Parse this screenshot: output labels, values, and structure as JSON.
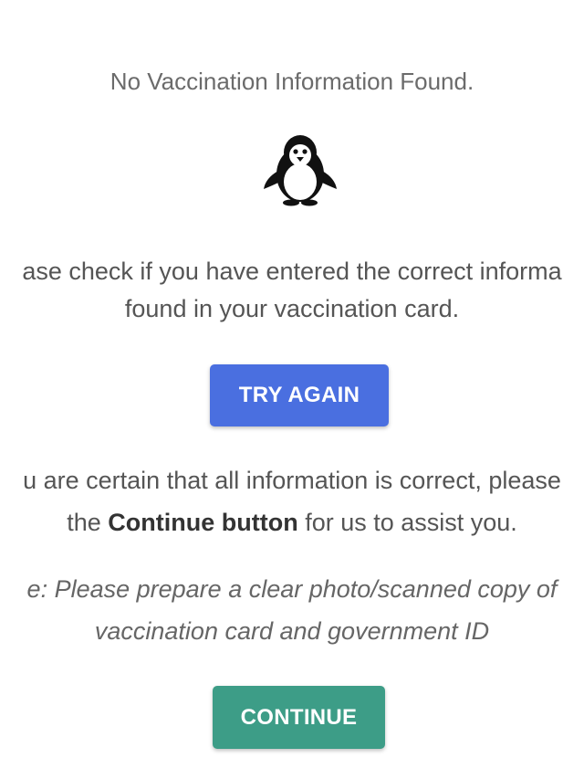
{
  "header": {
    "title": "No Vaccination Information Found."
  },
  "mascot": {
    "icon": "penguin-icon"
  },
  "message": {
    "line1": "ase check if you have entered the correct informa",
    "line2": "found in your vaccination card."
  },
  "try_again": {
    "label": "TRY AGAIN",
    "color": "#4a6fe0"
  },
  "assist": {
    "line1": "u are certain that all information is correct, please",
    "line2_prefix": "the ",
    "line2_bold": "Continue button",
    "line2_suffix": " for us to assist you."
  },
  "note": {
    "line1": "e: Please prepare a clear photo/scanned copy of",
    "line2": "vaccination card and government ID"
  },
  "continue": {
    "label": "CONTINUE",
    "color": "#3d9d87"
  }
}
